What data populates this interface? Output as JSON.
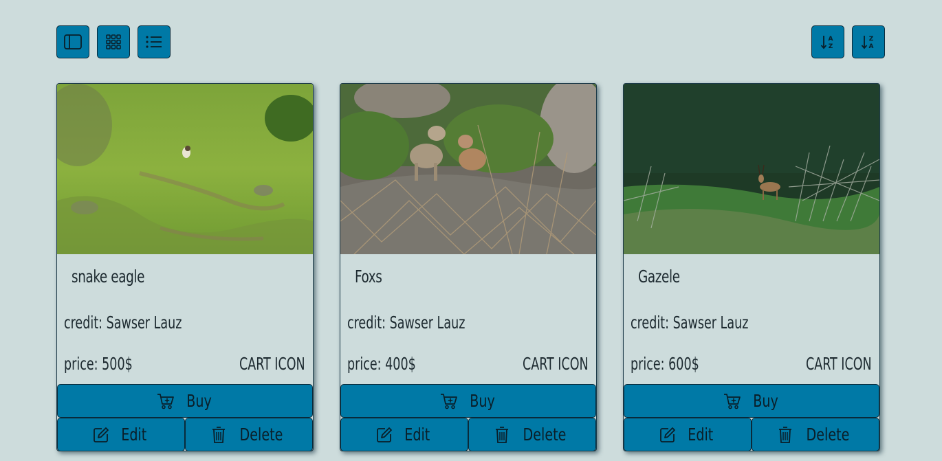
{
  "toolbar": {
    "left_buttons": [
      {
        "icon": "sidebar-layout-icon"
      },
      {
        "icon": "grid-view-icon"
      },
      {
        "icon": "list-view-icon"
      }
    ],
    "right_buttons": [
      {
        "icon": "sort-a-z-icon"
      },
      {
        "icon": "sort-z-a-icon"
      }
    ]
  },
  "cards": [
    {
      "image": "snake-eagle-photo",
      "title": "snake eagle",
      "credit": "credit: Sawser Lauz",
      "price": "price: 500$",
      "cart": "CART ICON",
      "buy_label": "Buy",
      "edit_label": "Edit",
      "delete_label": "Delete"
    },
    {
      "image": "foxes-photo",
      "title": "Foxs",
      "credit": "credit: Sawser Lauz",
      "price": "price: 400$",
      "cart": "CART ICON",
      "buy_label": "Buy",
      "edit_label": "Edit",
      "delete_label": "Delete"
    },
    {
      "image": "gazelle-photo",
      "title": "Gazele",
      "credit": "credit: Sawser Lauz",
      "price": "price: 600$",
      "cart": "CART ICON",
      "buy_label": "Buy",
      "edit_label": "Edit",
      "delete_label": "Delete"
    }
  ],
  "colors": {
    "background": "#cddcdc",
    "button": "#0079a6",
    "border": "#0a2a3a"
  }
}
